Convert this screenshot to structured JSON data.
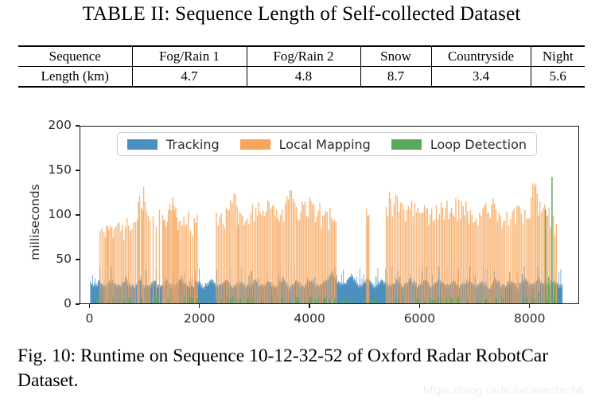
{
  "table": {
    "title": "TABLE II: Sequence Length of Self-collected Dataset",
    "columns": [
      "Sequence",
      "Fog/Rain 1",
      "Fog/Rain 2",
      "Snow",
      "Countryside",
      "Night"
    ],
    "rows": [
      {
        "label": "Length (km)",
        "values": [
          "4.7",
          "4.8",
          "8.7",
          "3.4",
          "5.6"
        ]
      }
    ]
  },
  "figure": {
    "caption": "Fig. 10: Runtime on Sequence 10-12-32-52 of Oxford Radar RobotCar Dataset.",
    "watermark": "https://blog.csdn.net/electech6"
  },
  "chart_data": {
    "type": "bar",
    "title": "",
    "xlabel": "",
    "ylabel": "milliseconds",
    "xlim": [
      -180,
      8900
    ],
    "ylim": [
      0,
      200
    ],
    "grid": false,
    "xticks": [
      0,
      2000,
      4000,
      6000,
      8000
    ],
    "xtick_labels": [
      "0",
      "2000",
      "4000",
      "6000",
      "8000"
    ],
    "yticks": [
      0,
      50,
      100,
      150,
      200
    ],
    "ytick_labels": [
      "0",
      "50",
      "100",
      "150",
      "200"
    ],
    "legend": {
      "position": "upper center",
      "entries": [
        {
          "name": "Tracking",
          "color": "#4c90c0"
        },
        {
          "name": "Local Mapping",
          "color": "#f7a55a"
        },
        {
          "name": "Loop Detection",
          "color": "#5aa85c"
        }
      ]
    },
    "series": [
      {
        "name": "Tracking",
        "color": "#4c90c0",
        "type": "dense-baseline",
        "description": "Per-frame tracking time, dense blue band spanning all frames, baseline roughly 15-25 ms with frequent small spikes to 30-40 ms.",
        "frame_range": [
          0,
          8600
        ],
        "baseline_ms": 19,
        "baseline_range_ms": [
          13,
          28
        ],
        "spike_max_ms": 42,
        "profile_ms": [
          22,
          20,
          19,
          21,
          24,
          20,
          18,
          19,
          22,
          25,
          21,
          19,
          18,
          20,
          23,
          27,
          21,
          19,
          18,
          20,
          22,
          24,
          20,
          18,
          17,
          19,
          21,
          23,
          20,
          18,
          19,
          21,
          24,
          22,
          19,
          18,
          20,
          22,
          25,
          21,
          19,
          18,
          17,
          19,
          22,
          24,
          21,
          19,
          18,
          20,
          23,
          26,
          22,
          19,
          18,
          19,
          21,
          24,
          22,
          20,
          18,
          19,
          21,
          23,
          21,
          19,
          18,
          20,
          22,
          25,
          23,
          20,
          18,
          19,
          21,
          23,
          21,
          19,
          18,
          20,
          23,
          28,
          24,
          20,
          18,
          19,
          22,
          25,
          22,
          19,
          18,
          20,
          23,
          26,
          23,
          20,
          18,
          19,
          21,
          24,
          26,
          30,
          34,
          28,
          24,
          21,
          19,
          20,
          23,
          27,
          31,
          26,
          22,
          19,
          18,
          20,
          23,
          26,
          23,
          20,
          18,
          19,
          22,
          25,
          22,
          20,
          18,
          19,
          21,
          24,
          22,
          19,
          18,
          20,
          23,
          27,
          24,
          21,
          19,
          20,
          22,
          25,
          22,
          19,
          18,
          20,
          23,
          26,
          23,
          20,
          18,
          19,
          21,
          24,
          21,
          19,
          18,
          20,
          22,
          25,
          23,
          20,
          18,
          19,
          21,
          24,
          22,
          20,
          18,
          19,
          22,
          26,
          23,
          20,
          18,
          19,
          21,
          24,
          22,
          19,
          18,
          20,
          23,
          27,
          24,
          21,
          19,
          20,
          23,
          27,
          24,
          21,
          19,
          20,
          22,
          25,
          22,
          20,
          18,
          19
        ]
      },
      {
        "name": "Local Mapping",
        "color": "#f7a55a",
        "type": "sparse-spikes",
        "description": "Local mapping thread runs intermittently; tall narrow orange spikes typically 70-135 ms, clustered in bursts with quiet gaps.",
        "spike_min_ms": 62,
        "spike_max_ms": 133,
        "typical_ms": 95,
        "spikes": [
          {
            "x": 180,
            "y": 82
          },
          {
            "x": 215,
            "y": 85
          },
          {
            "x": 250,
            "y": 80
          },
          {
            "x": 300,
            "y": 88
          },
          {
            "x": 340,
            "y": 83
          },
          {
            "x": 395,
            "y": 86
          },
          {
            "x": 440,
            "y": 84
          },
          {
            "x": 500,
            "y": 90
          },
          {
            "x": 560,
            "y": 82
          },
          {
            "x": 640,
            "y": 86
          },
          {
            "x": 700,
            "y": 88
          },
          {
            "x": 760,
            "y": 84
          },
          {
            "x": 860,
            "y": 95
          },
          {
            "x": 900,
            "y": 122
          },
          {
            "x": 935,
            "y": 108
          },
          {
            "x": 975,
            "y": 132
          },
          {
            "x": 1000,
            "y": 115
          },
          {
            "x": 1030,
            "y": 104
          },
          {
            "x": 1060,
            "y": 99
          },
          {
            "x": 1090,
            "y": 92
          },
          {
            "x": 1320,
            "y": 100
          },
          {
            "x": 1360,
            "y": 95
          },
          {
            "x": 1410,
            "y": 93
          },
          {
            "x": 1450,
            "y": 112
          },
          {
            "x": 1500,
            "y": 120
          },
          {
            "x": 1540,
            "y": 105
          },
          {
            "x": 1580,
            "y": 97
          },
          {
            "x": 1620,
            "y": 92
          },
          {
            "x": 1680,
            "y": 88
          },
          {
            "x": 1760,
            "y": 90
          },
          {
            "x": 1900,
            "y": 96
          },
          {
            "x": 1950,
            "y": 100
          },
          {
            "x": 2300,
            "y": 103
          },
          {
            "x": 2360,
            "y": 98
          },
          {
            "x": 2480,
            "y": 108
          },
          {
            "x": 2560,
            "y": 117
          },
          {
            "x": 2620,
            "y": 125
          },
          {
            "x": 2680,
            "y": 110
          },
          {
            "x": 2720,
            "y": 104
          },
          {
            "x": 2780,
            "y": 99
          },
          {
            "x": 2860,
            "y": 96
          },
          {
            "x": 2960,
            "y": 112
          },
          {
            "x": 3020,
            "y": 108
          },
          {
            "x": 3100,
            "y": 103
          },
          {
            "x": 3180,
            "y": 99
          },
          {
            "x": 3260,
            "y": 115
          },
          {
            "x": 3320,
            "y": 110
          },
          {
            "x": 3400,
            "y": 106
          },
          {
            "x": 3470,
            "y": 100
          },
          {
            "x": 3560,
            "y": 113
          },
          {
            "x": 3640,
            "y": 128
          },
          {
            "x": 3700,
            "y": 118
          },
          {
            "x": 3760,
            "y": 109
          },
          {
            "x": 3840,
            "y": 104
          },
          {
            "x": 3920,
            "y": 115
          },
          {
            "x": 4000,
            "y": 120
          },
          {
            "x": 4080,
            "y": 111
          },
          {
            "x": 4160,
            "y": 105
          },
          {
            "x": 4240,
            "y": 99
          },
          {
            "x": 4320,
            "y": 103
          },
          {
            "x": 4400,
            "y": 97
          },
          {
            "x": 4480,
            "y": 92
          },
          {
            "x": 5040,
            "y": 107
          },
          {
            "x": 5080,
            "y": 100
          },
          {
            "x": 5400,
            "y": 109
          },
          {
            "x": 5480,
            "y": 118
          },
          {
            "x": 5540,
            "y": 112
          },
          {
            "x": 5600,
            "y": 121
          },
          {
            "x": 5660,
            "y": 114
          },
          {
            "x": 5720,
            "y": 106
          },
          {
            "x": 5800,
            "y": 110
          },
          {
            "x": 5860,
            "y": 116
          },
          {
            "x": 5920,
            "y": 113
          },
          {
            "x": 5980,
            "y": 108
          },
          {
            "x": 6040,
            "y": 102
          },
          {
            "x": 6120,
            "y": 107
          },
          {
            "x": 6200,
            "y": 100
          },
          {
            "x": 6280,
            "y": 95
          },
          {
            "x": 6400,
            "y": 114
          },
          {
            "x": 6480,
            "y": 108
          },
          {
            "x": 6560,
            "y": 103
          },
          {
            "x": 6640,
            "y": 98
          },
          {
            "x": 6720,
            "y": 117
          },
          {
            "x": 6800,
            "y": 110
          },
          {
            "x": 6880,
            "y": 104
          },
          {
            "x": 6960,
            "y": 100
          },
          {
            "x": 7040,
            "y": 96
          },
          {
            "x": 7160,
            "y": 108
          },
          {
            "x": 7240,
            "y": 102
          },
          {
            "x": 7320,
            "y": 112
          },
          {
            "x": 7400,
            "y": 106
          },
          {
            "x": 7480,
            "y": 99
          },
          {
            "x": 7560,
            "y": 94
          },
          {
            "x": 7700,
            "y": 104
          },
          {
            "x": 7780,
            "y": 110
          },
          {
            "x": 7860,
            "y": 101
          },
          {
            "x": 7960,
            "y": 96
          },
          {
            "x": 8040,
            "y": 120
          },
          {
            "x": 8100,
            "y": 133
          },
          {
            "x": 8150,
            "y": 124
          },
          {
            "x": 8200,
            "y": 115
          },
          {
            "x": 8260,
            "y": 108
          },
          {
            "x": 8340,
            "y": 100
          },
          {
            "x": 8420,
            "y": 95
          },
          {
            "x": 8500,
            "y": 90
          }
        ]
      },
      {
        "name": "Loop Detection",
        "color": "#5aa85c",
        "type": "sparse-spikes",
        "description": "Loop detection fires rarely; short green marks near the baseline for most of the run with two tall spikes toward the end of the sequence around frames 8300-8450.",
        "spike_max_ms": 143,
        "spikes": [
          {
            "x": 1180,
            "y": 6
          },
          {
            "x": 2400,
            "y": 5
          },
          {
            "x": 3500,
            "y": 6
          },
          {
            "x": 4600,
            "y": 5
          },
          {
            "x": 5700,
            "y": 7
          },
          {
            "x": 6600,
            "y": 6
          },
          {
            "x": 7400,
            "y": 6
          },
          {
            "x": 8050,
            "y": 9
          },
          {
            "x": 8180,
            "y": 12
          },
          {
            "x": 8300,
            "y": 106
          },
          {
            "x": 8360,
            "y": 30
          },
          {
            "x": 8420,
            "y": 143
          },
          {
            "x": 8470,
            "y": 22
          },
          {
            "x": 8520,
            "y": 14
          }
        ]
      }
    ]
  }
}
